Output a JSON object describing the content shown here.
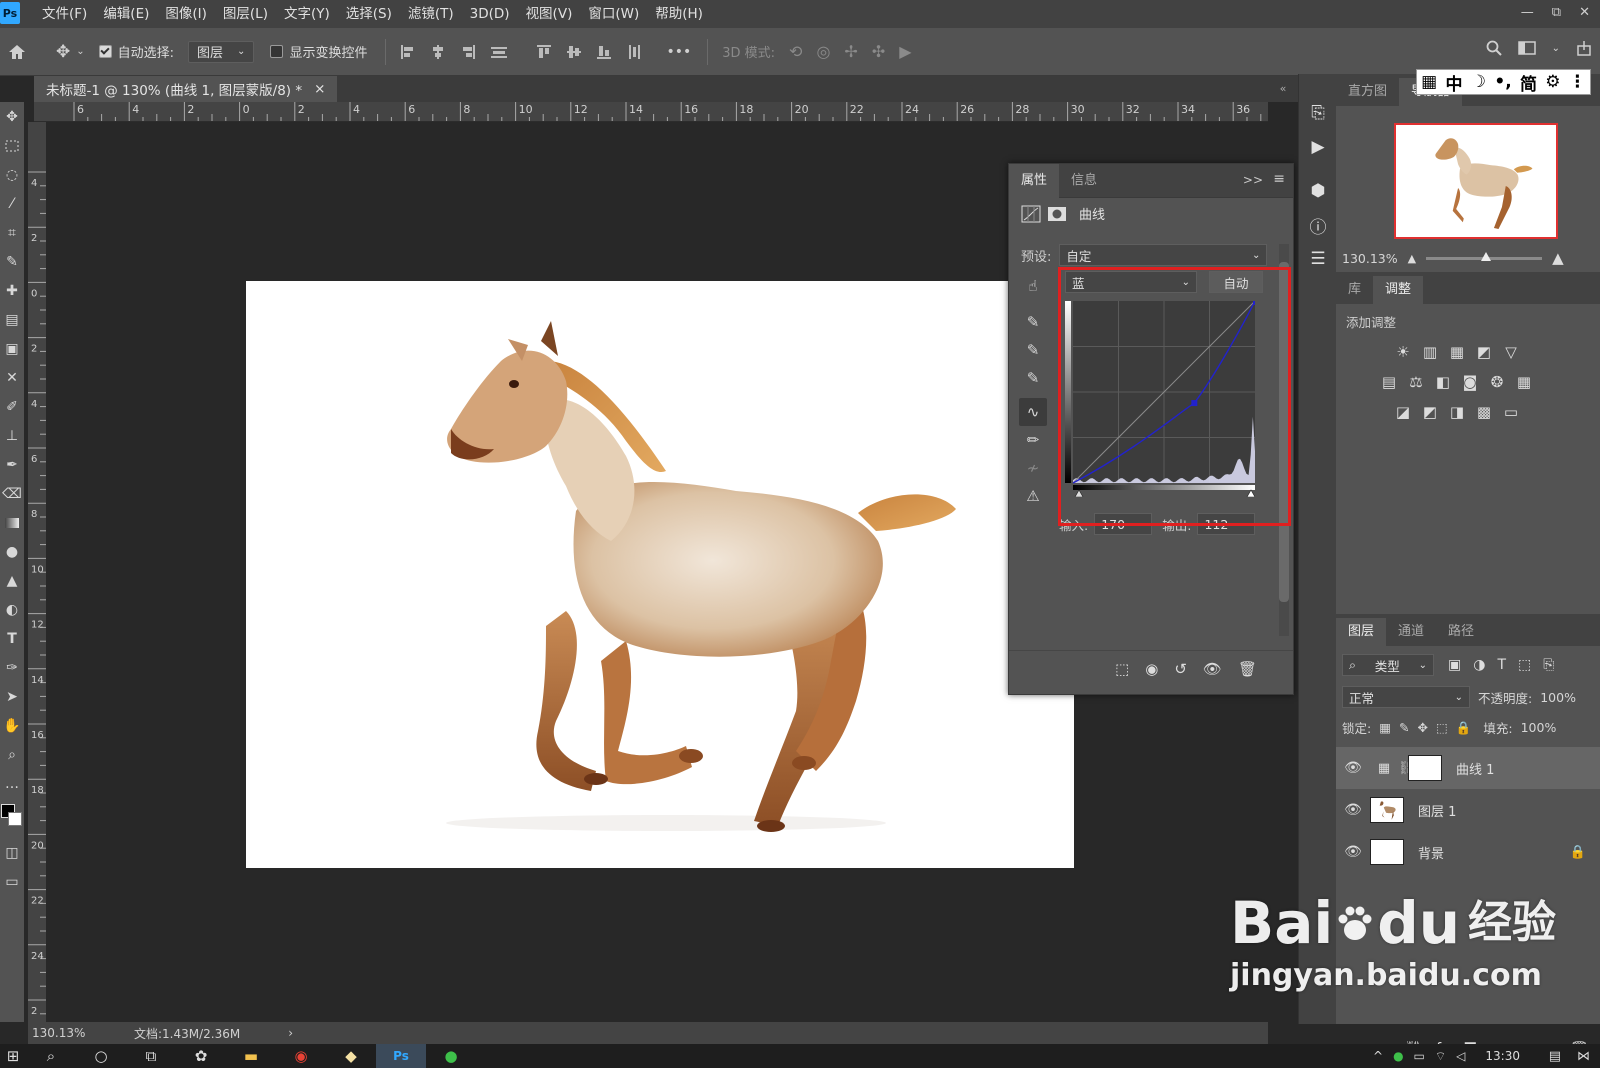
{
  "app": {
    "logo": "Ps",
    "name": "Adobe Photoshop"
  },
  "menu": [
    "文件(F)",
    "编辑(E)",
    "图像(I)",
    "图层(L)",
    "文字(Y)",
    "选择(S)",
    "滤镜(T)",
    "3D(D)",
    "视图(V)",
    "窗口(W)",
    "帮助(H)"
  ],
  "window_controls": {
    "minimize": "—",
    "restore": "⧉",
    "close": "✕"
  },
  "options": {
    "auto_select_label": "自动选择:",
    "auto_select_checked": true,
    "auto_select_target": "图层",
    "show_transform_label": "显示变换控件",
    "show_transform_checked": false,
    "more": "•••",
    "mode_3d_label": "3D 模式:"
  },
  "document_tab": {
    "title": "未标题-1 @ 130% (曲线 1, 图层蒙版/8) *",
    "close": "×"
  },
  "ruler": {
    "top_labels": [
      "6",
      "4",
      "2",
      "0",
      "2",
      "4",
      "6",
      "8",
      "10",
      "12",
      "14",
      "16",
      "18",
      "20",
      "22",
      "24",
      "26",
      "28",
      "30",
      "32",
      "34",
      "36"
    ],
    "left_labels": [
      "4",
      "2",
      "0",
      "2",
      "4",
      "6",
      "8",
      "10",
      "12",
      "14",
      "16",
      "18",
      "20",
      "22",
      "24",
      "2"
    ]
  },
  "status": {
    "zoom": "130.13%",
    "doc": "文档:1.43M/2.36M",
    "arrow": "›"
  },
  "properties": {
    "tabs": [
      "属性",
      "信息"
    ],
    "expand": ">>",
    "menu": "≡",
    "layer_type": "曲线",
    "preset_label": "预设:",
    "preset_value": "自定",
    "channel": "蓝",
    "auto_button": "自动",
    "input_label": "输入:",
    "input_value": "170",
    "output_label": "输出:",
    "output_value": "112"
  },
  "curve": {
    "input": 170,
    "output": 112,
    "channel_color": "#2222cc"
  },
  "navigator": {
    "tabs": [
      "直方图",
      "导航器"
    ],
    "zoom": "130.13%"
  },
  "adjustments": {
    "tabs": [
      "库",
      "调整"
    ],
    "heading": "添加调整"
  },
  "layers": {
    "tabs": [
      "图层",
      "通道",
      "路径"
    ],
    "filter_label": "类型",
    "blend_mode": "正常",
    "opacity_label": "不透明度:",
    "opacity_value": "100%",
    "lock_label": "锁定:",
    "fill_label": "填充:",
    "fill_value": "100%",
    "items": [
      {
        "name": "曲线 1",
        "visible": true,
        "selected": true
      },
      {
        "name": "图层 1",
        "visible": true,
        "selected": false
      },
      {
        "name": "背景",
        "visible": true,
        "selected": false,
        "locked": true
      }
    ]
  },
  "ime": {
    "items": [
      "中",
      "简"
    ]
  },
  "taskbar": {
    "time": "13:30"
  },
  "watermark": {
    "brand": "Bai",
    "brand2": "du",
    "brand_cn": "经验",
    "url": "jingyan.baidu.com"
  }
}
